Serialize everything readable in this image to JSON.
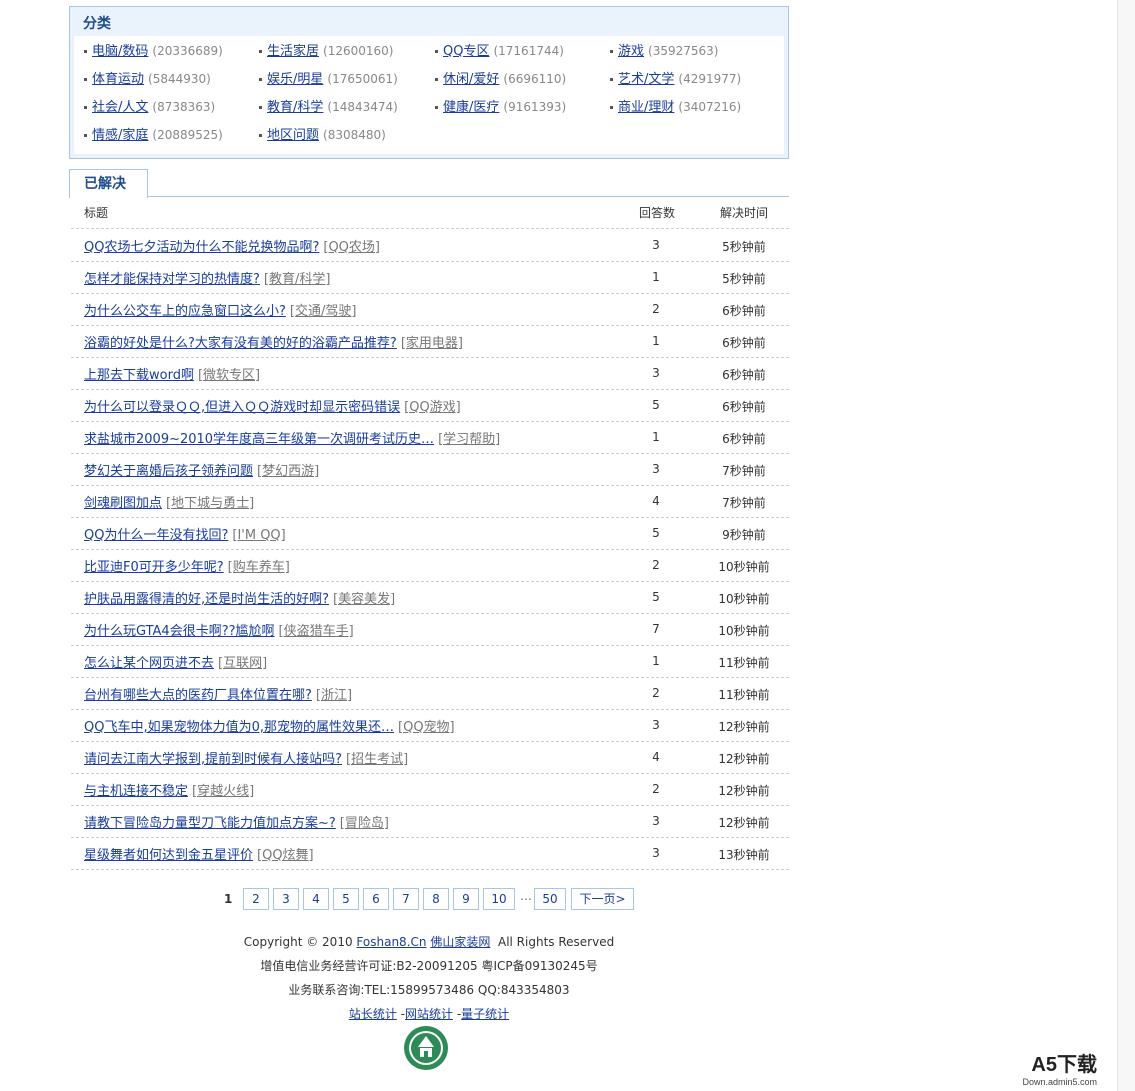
{
  "categories": {
    "title": "分类",
    "items": [
      {
        "label": "电脑/数码",
        "count": "(20336689)"
      },
      {
        "label": "生活家居",
        "count": "(12600160)"
      },
      {
        "label": "QQ专区",
        "count": "(17161744)"
      },
      {
        "label": "游戏",
        "count": "(35927563)"
      },
      {
        "label": "体育运动",
        "count": "(5844930)"
      },
      {
        "label": "娱乐/明星",
        "count": "(17650061)"
      },
      {
        "label": "休闲/爱好",
        "count": "(6696110)"
      },
      {
        "label": "艺术/文学",
        "count": "(4291977)"
      },
      {
        "label": "社会/人文",
        "count": "(8738363)"
      },
      {
        "label": "教育/科学",
        "count": "(14843474)"
      },
      {
        "label": "健康/医疗",
        "count": "(9161393)"
      },
      {
        "label": "商业/理财",
        "count": "(3407216)"
      },
      {
        "label": "情感/家庭",
        "count": "(20889525)"
      },
      {
        "label": "地区问题",
        "count": "(8308480)"
      }
    ]
  },
  "tab": {
    "label": "已解决"
  },
  "table": {
    "headers": {
      "title": "标题",
      "answers": "回答数",
      "time": "解决时间"
    },
    "rows": [
      {
        "title": "QQ农场七夕活动为什么不能兑换物品啊?",
        "tag": "[QQ农场]",
        "answers": "3",
        "time": "5秒钟前"
      },
      {
        "title": "怎样才能保持对学习的热情度?",
        "tag": "[教育/科学]",
        "answers": "1",
        "time": "5秒钟前"
      },
      {
        "title": "为什么公交车上的应急窗口这么小?",
        "tag": "[交通/驾驶]",
        "answers": "2",
        "time": "6秒钟前"
      },
      {
        "title": "浴霸的好处是什么?大家有没有美的好的浴霸产品推荐?",
        "tag": "[家用电器]",
        "answers": "1",
        "time": "6秒钟前"
      },
      {
        "title": "上那去下载word啊",
        "tag": "[微软专区]",
        "answers": "3",
        "time": "6秒钟前"
      },
      {
        "title": "为什么可以登录ＱＱ,但进入ＱＱ游戏时却显示密码错误",
        "tag": "[QQ游戏]",
        "answers": "5",
        "time": "6秒钟前"
      },
      {
        "title": "求盐城市2009~2010学年度高三年级第一次调研考试历史…",
        "tag": "[学习帮助]",
        "answers": "1",
        "time": "6秒钟前"
      },
      {
        "title": "梦幻关于离婚后孩子领养问题",
        "tag": "[梦幻西游]",
        "answers": "3",
        "time": "7秒钟前"
      },
      {
        "title": "剑魂刷图加点",
        "tag": "[地下城与勇士]",
        "answers": "4",
        "time": "7秒钟前"
      },
      {
        "title": "QQ为什么一年没有找回?",
        "tag": "[I'M QQ]",
        "answers": "5",
        "time": "9秒钟前"
      },
      {
        "title": "比亚迪F0可开多少年呢?",
        "tag": "[购车养车]",
        "answers": "2",
        "time": "10秒钟前"
      },
      {
        "title": "护肤品用露得清的好,还是时尚生活的好啊?",
        "tag": "[美容美发]",
        "answers": "5",
        "time": "10秒钟前"
      },
      {
        "title": "为什么玩GTA4会很卡啊??尴尬啊",
        "tag": "[侠盗猎车手]",
        "answers": "7",
        "time": "10秒钟前"
      },
      {
        "title": "怎么让某个网页进不去",
        "tag": "[互联网]",
        "answers": "1",
        "time": "11秒钟前"
      },
      {
        "title": "台州有哪些大点的医药厂具体位置在哪?",
        "tag": "[浙江]",
        "answers": "2",
        "time": "11秒钟前"
      },
      {
        "title": "QQ飞车中,如果宠物体力值为0,那宠物的属性效果还…",
        "tag": "[QQ宠物]",
        "answers": "3",
        "time": "12秒钟前"
      },
      {
        "title": "请问去江南大学报到,提前到时候有人接站吗?",
        "tag": "[招生考试]",
        "answers": "4",
        "time": "12秒钟前"
      },
      {
        "title": "与主机连接不稳定",
        "tag": "[穿越火线]",
        "answers": "2",
        "time": "12秒钟前"
      },
      {
        "title": "请教下冒险岛力量型刀飞能力值加点方案~?",
        "tag": "[冒险岛]",
        "answers": "3",
        "time": "12秒钟前"
      },
      {
        "title": "星级舞者如何达到金五星评价",
        "tag": "[QQ炫舞]",
        "answers": "3",
        "time": "13秒钟前"
      }
    ]
  },
  "pagination": {
    "current": "1",
    "pages": [
      "2",
      "3",
      "4",
      "5",
      "6",
      "7",
      "8",
      "9",
      "10"
    ],
    "ellipsis": "…",
    "last": "50",
    "next": "下一页>"
  },
  "footer": {
    "copyright_prefix": "Copyright © 2010",
    "site_link": "Foshan8.Cn",
    "site_name": "佛山家装网",
    "rights": "All Rights Reserved",
    "license": "增值电信业务经营许可证:B2-20091205 粤ICP备09130245号",
    "contact": "业务联系咨询:TEL:15899573486 QQ:843354803",
    "links": [
      "站长统计",
      "网站统计",
      "量子统计"
    ]
  },
  "watermark": {
    "brand": "A5下载",
    "domain": "Down.admin5.com"
  },
  "colors": {
    "link": "#1a3d9a",
    "border": "#a9c6e3",
    "box_bg": "#eaf3fc"
  }
}
